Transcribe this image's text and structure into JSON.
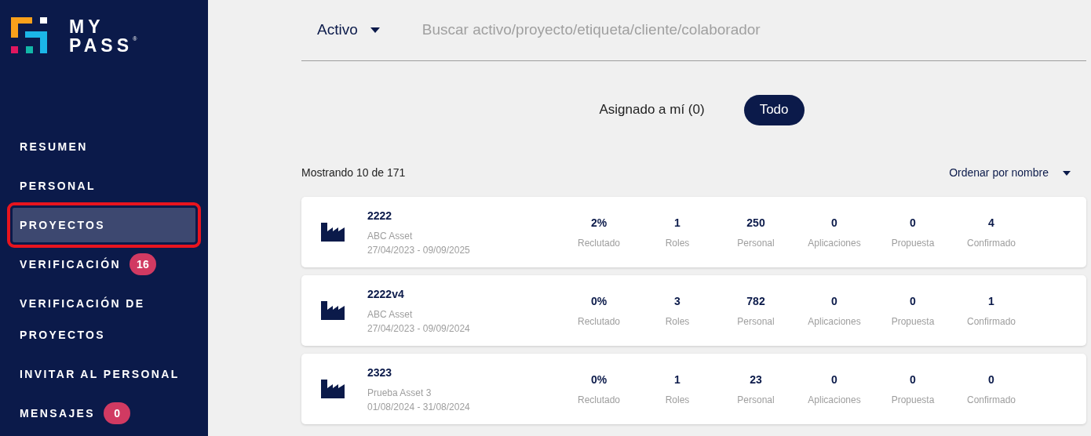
{
  "logo": {
    "line_1": "MY",
    "line_2": "PASS",
    "mark": "®"
  },
  "nav": [
    {
      "label": "RESUMEN",
      "selected": false,
      "outlined": false
    },
    {
      "label": "PERSONAL",
      "selected": false,
      "outlined": false
    },
    {
      "label": "PROYECTOS",
      "selected": true,
      "outlined": true
    },
    {
      "label": "VERIFICACIÓN",
      "selected": false,
      "outlined": false,
      "badge": "16"
    },
    {
      "label": "VERIFICACIÓN DE PROYECTOS",
      "selected": false,
      "outlined": false
    },
    {
      "label": "INVITAR AL PERSONAL",
      "selected": false,
      "outlined": false
    },
    {
      "label": "MENSAJES",
      "selected": false,
      "outlined": false,
      "badge": "0"
    }
  ],
  "search": {
    "filter": "Activo",
    "placeholder": "Buscar activo/proyecto/etiqueta/cliente/colaborador"
  },
  "toggle": [
    {
      "label": "Asignado a mí (0)",
      "selected": false
    },
    {
      "label": "Todo",
      "selected": true
    }
  ],
  "count": "Mostrando 10 de 171",
  "sort": "Ordenar por nombre",
  "projects": [
    {
      "name": "2222",
      "asset": "ABC Asset",
      "dates": "27/04/2023 - 09/09/2025",
      "stats": [
        {
          "value": "2%",
          "label": "Reclutado"
        },
        {
          "value": "1",
          "label": "Roles"
        },
        {
          "value": "250",
          "label": "Personal"
        },
        {
          "value": "0",
          "label": "Aplicaciones"
        },
        {
          "value": "0",
          "label": "Propuesta"
        },
        {
          "value": "4",
          "label": "Confirmado"
        }
      ]
    },
    {
      "name": "2222v4",
      "asset": "ABC Asset",
      "dates": "27/04/2023 - 09/09/2024",
      "stats": [
        {
          "value": "0%",
          "label": "Reclutado"
        },
        {
          "value": "3",
          "label": "Roles"
        },
        {
          "value": "782",
          "label": "Personal"
        },
        {
          "value": "0",
          "label": "Aplicaciones"
        },
        {
          "value": "0",
          "label": "Propuesta"
        },
        {
          "value": "1",
          "label": "Confirmado"
        }
      ]
    },
    {
      "name": "2323",
      "asset": "Prueba Asset 3",
      "dates": "01/08/2024 - 31/08/2024",
      "stats": [
        {
          "value": "0%",
          "label": "Reclutado"
        },
        {
          "value": "1",
          "label": "Roles"
        },
        {
          "value": "23",
          "label": "Personal"
        },
        {
          "value": "0",
          "label": "Aplicaciones"
        },
        {
          "value": "0",
          "label": "Propuesta"
        },
        {
          "value": "0",
          "label": "Confirmado"
        }
      ]
    }
  ]
}
